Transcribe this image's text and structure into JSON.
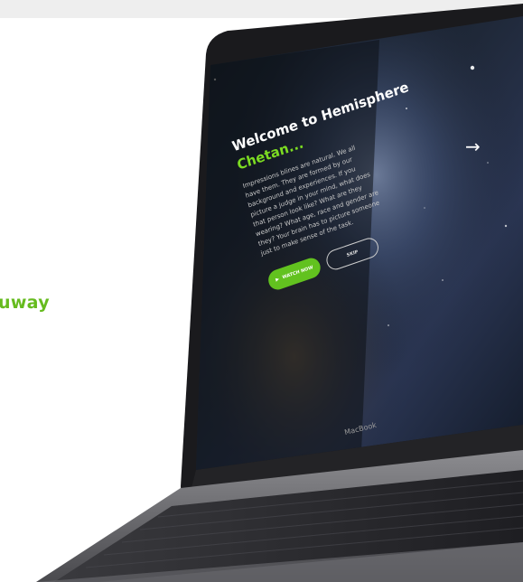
{
  "side_text": "uway",
  "screen": {
    "title": "Welcome to Hemisphere",
    "name": "Chetan...",
    "paragraph": "Impressions blines are natural. We all have them. They are formed by our background and experiences. If you picture a judge in your mind, what does that person look like? What are they wearing? What age, race and gender are they? Your brain has to picture someone just to make sense of the task.",
    "buttons": {
      "watch_now": "WATCH NOW",
      "skip": "SKIP"
    },
    "next_arrow": "→"
  },
  "device_label": "MacBook",
  "colors": {
    "accent_green": "#62c21f",
    "side_text_green": "#66bb1f"
  },
  "icons": {
    "watch_play": "play-icon",
    "next": "arrow-right-icon"
  }
}
